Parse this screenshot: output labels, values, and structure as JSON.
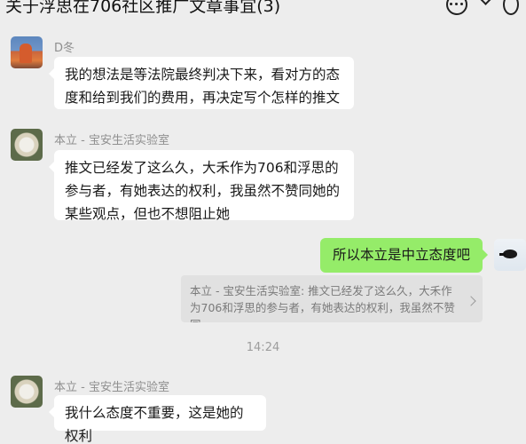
{
  "header": {
    "title": "关于浮思在706社区推广文章事宜(3)",
    "actions": {
      "more": "more-icon",
      "chevron": "chevron-down-icon",
      "right": "profile-icon"
    }
  },
  "messages": [
    {
      "sender": "D冬",
      "text": "我的想法是等法院最终判决下来，看对方的态度和给到我们的费用，再决定写个怎样的推文"
    },
    {
      "sender": "本立 - 宝安生活实验室",
      "text": "推文已经发了这么久，大禾作为706和浮思的参与者，有她表达的权利，我虽然不赞同她的某些观点，但也不想阻止她"
    },
    {
      "sender": "me",
      "text": "所以本立是中立态度吧"
    },
    {
      "sender": "本立 - 宝安生活实验室",
      "text": "我什么态度不重要，这是她的权利"
    }
  ],
  "quote": {
    "text": "本立 - 宝安生活实验室: 推文已经发了这么久，大禾作为706和浮思的参与者，有她表达的权利，我虽然不赞同..."
  },
  "time": "14:24",
  "colors": {
    "background": "#ededed",
    "incoming_bubble": "#ffffff",
    "outgoing_bubble": "#95ec69",
    "quote_bg": "#e1e1e1"
  }
}
